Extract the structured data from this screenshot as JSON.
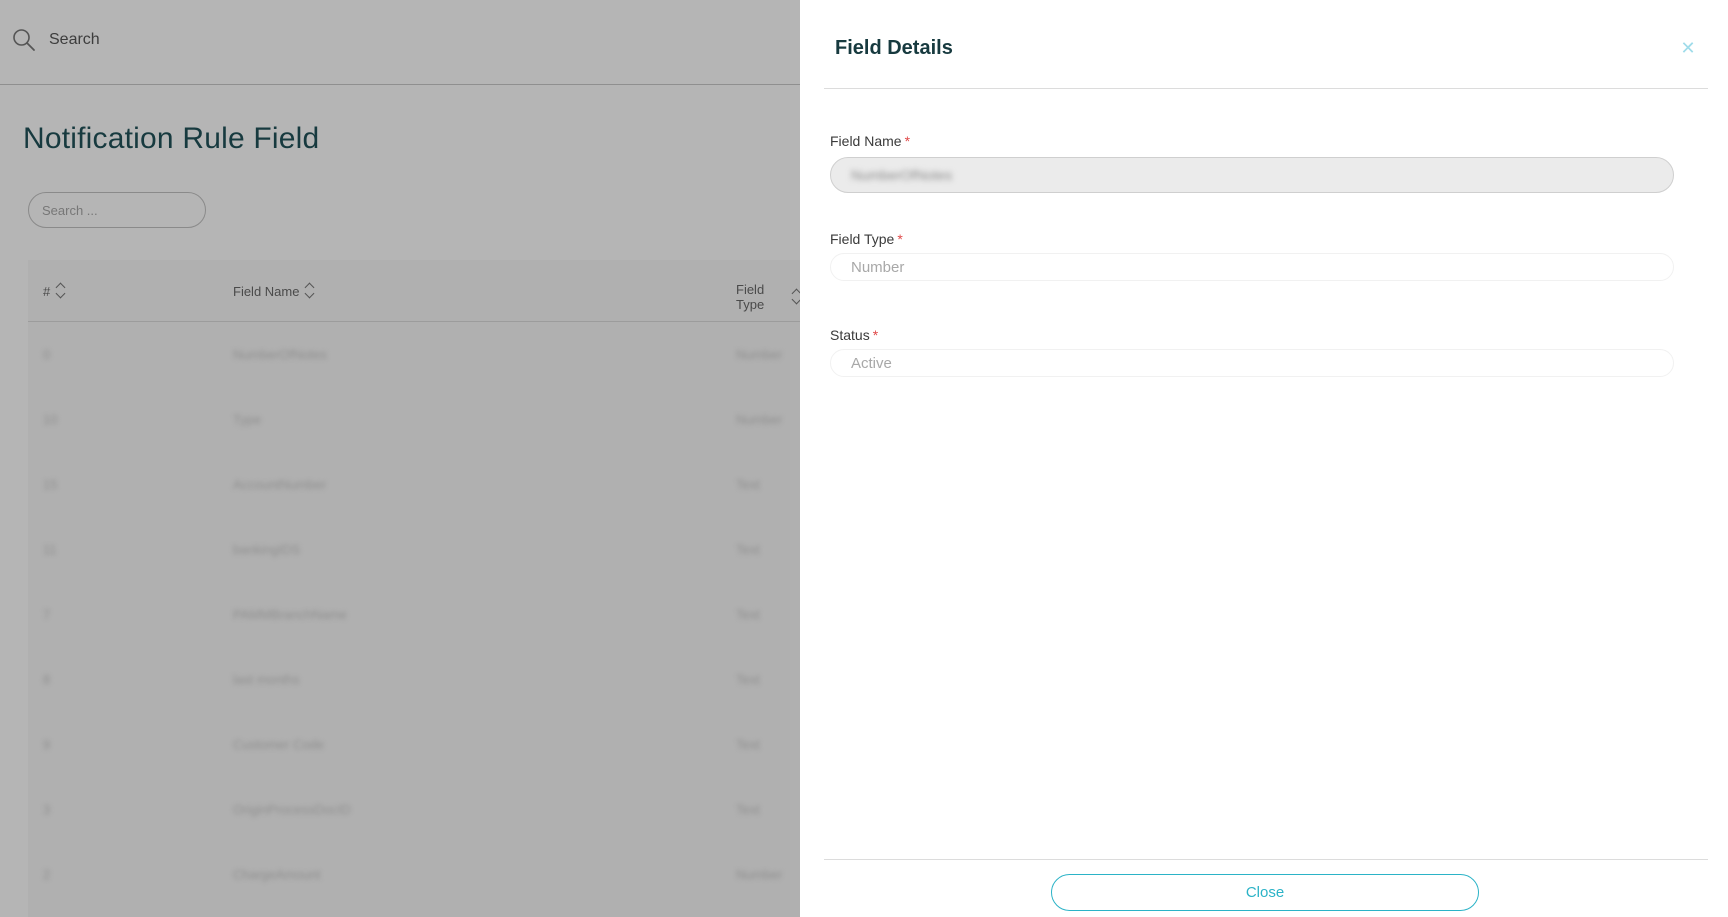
{
  "background": {
    "topbar": {
      "search_label": "Search"
    },
    "page_title": "Notification Rule Field",
    "search_placeholder": "Search ...",
    "table": {
      "columns": [
        "#",
        "Field Name",
        "Field Type"
      ],
      "rows": [
        [
          "0",
          "NumberOfNotes",
          "Number"
        ],
        [
          "10",
          "Type",
          "Number"
        ],
        [
          "15",
          "AccountNumber",
          "Text"
        ],
        [
          "11",
          "bankingIDS",
          "Text"
        ],
        [
          "7",
          "PAMMBranchName",
          "Text"
        ],
        [
          "8",
          "last months",
          "Text"
        ],
        [
          "9",
          "Customer Code",
          "Text"
        ],
        [
          "3",
          "OriginProcessDocID",
          "Text"
        ],
        [
          "2",
          "ChargeAmount",
          "Number"
        ]
      ]
    }
  },
  "drawer": {
    "title": "Field Details",
    "close_icon": "close-icon",
    "fields": {
      "field_name": {
        "label": "Field Name",
        "required": "*",
        "value": "NumberOfNotes"
      },
      "field_type": {
        "label": "Field Type",
        "required": "*",
        "value": "Number"
      },
      "status": {
        "label": "Status",
        "required": "*",
        "value": "Active"
      }
    },
    "close_label": "Close"
  },
  "colors": {
    "accent": "#2bb3c7",
    "title": "#173a3f",
    "required": "#e04848",
    "overlay": "#b5b5b5"
  }
}
